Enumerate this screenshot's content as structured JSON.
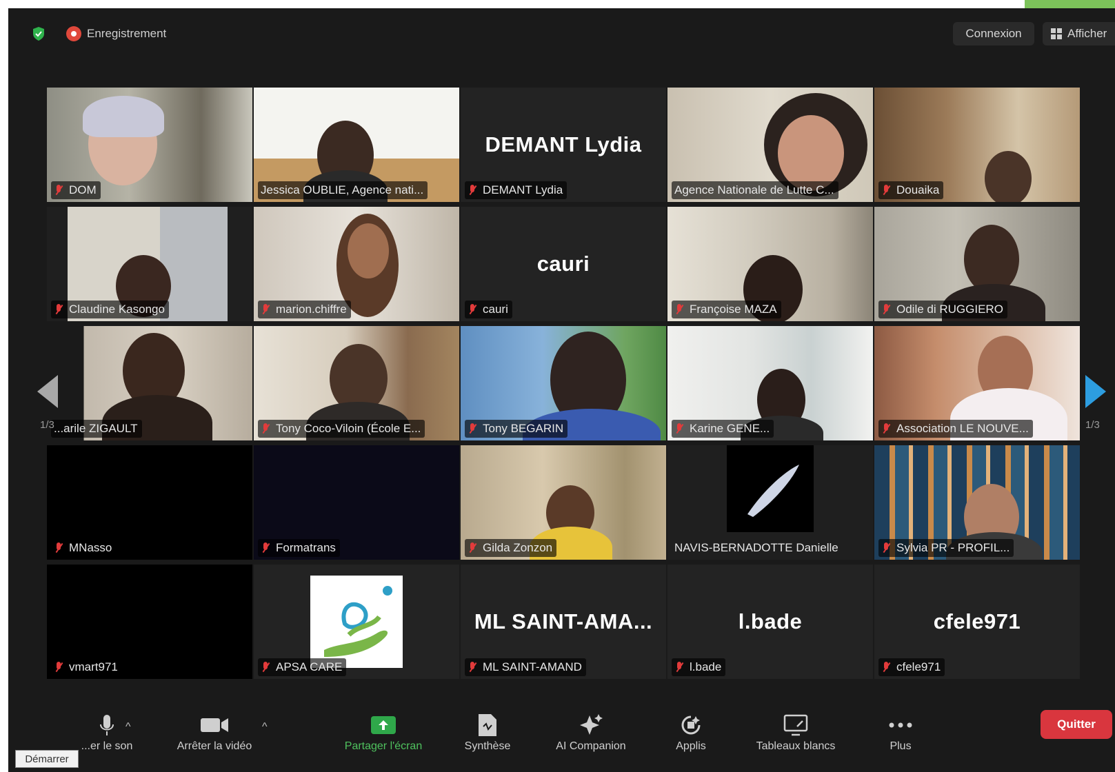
{
  "topbar": {
    "recording_label": "Enregistrement",
    "connexion_label": "Connexion",
    "view_label": "Afficher"
  },
  "pagination": {
    "left": "1/3",
    "right": "1/3"
  },
  "tiles": [
    {
      "name": "DOM",
      "display": ""
    },
    {
      "name": "Jessica OUBLIE, Agence nati...",
      "display": ""
    },
    {
      "name": "DEMANT Lydia",
      "display": "DEMANT Lydia"
    },
    {
      "name": "Agence Nationale de Lutte C...",
      "display": ""
    },
    {
      "name": "Douaika",
      "display": ""
    },
    {
      "name": "Claudine Kasongo",
      "display": ""
    },
    {
      "name": "marion.chiffre",
      "display": ""
    },
    {
      "name": "cauri",
      "display": "cauri"
    },
    {
      "name": "Françoise MAZA",
      "display": ""
    },
    {
      "name": "Odile di RUGGIERO",
      "display": ""
    },
    {
      "name": "...arile ZIGAULT",
      "display": ""
    },
    {
      "name": "Tony Coco-Viloin (École E...",
      "display": ""
    },
    {
      "name": "Tony BEGARIN",
      "display": ""
    },
    {
      "name": "Karine GENE...",
      "display": ""
    },
    {
      "name": "Association LE NOUVE...",
      "display": ""
    },
    {
      "name": "MNasso",
      "display": ""
    },
    {
      "name": "Formatrans",
      "display": ""
    },
    {
      "name": "Gilda Zonzon",
      "display": ""
    },
    {
      "name": "NAVIS-BERNADOTTE Danielle",
      "display": ""
    },
    {
      "name": "Sylvia PR - PROFIL...",
      "display": ""
    },
    {
      "name": "vmart971",
      "display": ""
    },
    {
      "name": "APSA CARE",
      "display": ""
    },
    {
      "name": "ML SAINT-AMAND",
      "display": "ML  SAINT-AMA..."
    },
    {
      "name": "l.bade",
      "display": "l.bade"
    },
    {
      "name": "cfele971",
      "display": "cfele971"
    }
  ],
  "toolbar": {
    "audio_label": "...er le son",
    "video_label": "Arrêter la vidéo",
    "share_label": "Partager l'écran",
    "summary_label": "Synthèse",
    "companion_label": "AI Companion",
    "apps_label": "Applis",
    "whiteboard_label": "Tableaux blancs",
    "more_label": "Plus",
    "quit_label": "Quitter",
    "tooltip_label": "Démarrer"
  },
  "colors": {
    "active_border": "#d7e84b",
    "share_green": "#4fc25e",
    "quit_red": "#d9363e",
    "next_arrow": "#2d9de0"
  }
}
